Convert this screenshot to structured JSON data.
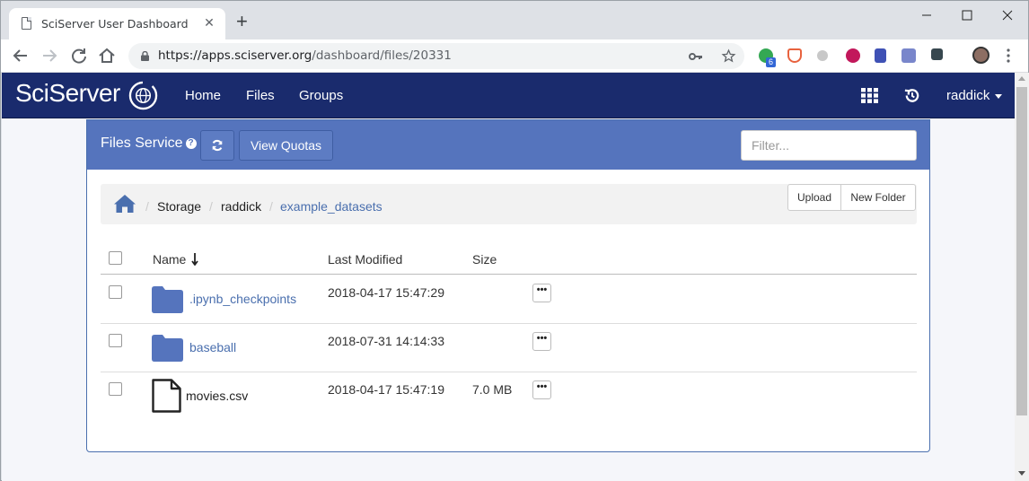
{
  "browser": {
    "tab_title": "SciServer User Dashboard",
    "tab_close": "✕",
    "new_tab": "+",
    "url_host": "https://apps.sciserver.org",
    "url_path": "/dashboard/files/20331",
    "extension_badge": "6",
    "window_controls": [
      "minimize-icon",
      "maximize-icon",
      "close-icon"
    ]
  },
  "navbar": {
    "brand": "SciServer",
    "links": [
      "Home",
      "Files",
      "Groups"
    ],
    "user": "raddick",
    "bg_color": "#1a2b6d"
  },
  "panel": {
    "title": "Files Service",
    "refresh_icon": "refresh-icon",
    "view_quotas": "View Quotas",
    "filter_placeholder": "Filter...",
    "header_color": "#5574bd"
  },
  "breadcrumb": {
    "items": [
      "Storage",
      "raddick",
      "example_datasets"
    ],
    "separator": "/",
    "upload": "Upload",
    "new_folder": "New Folder"
  },
  "table": {
    "headers": {
      "name": "Name",
      "modified": "Last Modified",
      "size": "Size"
    },
    "sort_indicator": "arrow-down-icon",
    "rows": [
      {
        "type": "folder",
        "name": ".ipynb_checkpoints",
        "modified": "2018-04-17 15:47:29",
        "size": ""
      },
      {
        "type": "folder",
        "name": "baseball",
        "modified": "2018-07-31 14:14:33",
        "size": ""
      },
      {
        "type": "file",
        "name": "movies.csv",
        "modified": "2018-04-17 15:47:19",
        "size": "7.0 MB"
      }
    ],
    "row_action": "•••"
  }
}
